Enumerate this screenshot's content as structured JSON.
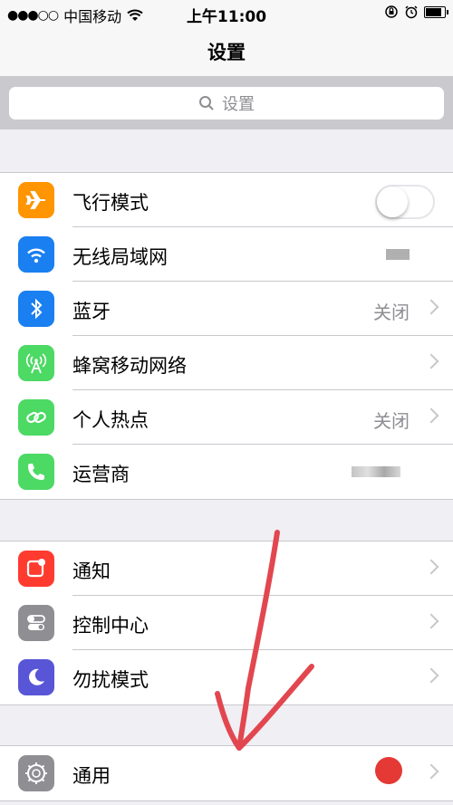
{
  "status_bar": {
    "signal": "●●●○○",
    "carrier": "中国移动",
    "time": "上午11:00"
  },
  "nav": {
    "title": "设置"
  },
  "search": {
    "placeholder": "设置"
  },
  "groups": [
    {
      "rows": [
        {
          "label": "飞行模式",
          "icon": "airplane-icon",
          "color": "#ff9500",
          "accessory": "toggle",
          "toggle_on": false
        },
        {
          "label": "无线局域网",
          "icon": "wifi-icon",
          "color": "#1a7ff0",
          "accessory": "blurred-value"
        },
        {
          "label": "蓝牙",
          "icon": "bluetooth-icon",
          "color": "#1a7ff0",
          "value": "关闭",
          "accessory": "chevron"
        },
        {
          "label": "蜂窝移动网络",
          "icon": "cellular-antenna-icon",
          "color": "#4cd964",
          "accessory": "chevron"
        },
        {
          "label": "个人热点",
          "icon": "hotspot-link-icon",
          "color": "#4cd964",
          "value": "关闭",
          "accessory": "chevron"
        },
        {
          "label": "运营商",
          "icon": "phone-icon",
          "color": "#4cd964",
          "accessory": "blurred-value"
        }
      ]
    },
    {
      "rows": [
        {
          "label": "通知",
          "icon": "notifications-icon",
          "color": "#ff3b30",
          "accessory": "chevron"
        },
        {
          "label": "控制中心",
          "icon": "control-center-icon",
          "color": "#8e8e93",
          "accessory": "chevron"
        },
        {
          "label": "勿扰模式",
          "icon": "moon-icon",
          "color": "#5856d6",
          "accessory": "chevron"
        }
      ]
    },
    {
      "rows": [
        {
          "label": "通用",
          "icon": "gear-icon",
          "color": "#8e8e93",
          "accessory": "chevron"
        }
      ]
    }
  ],
  "annotation": {
    "color": "#e2474f"
  }
}
